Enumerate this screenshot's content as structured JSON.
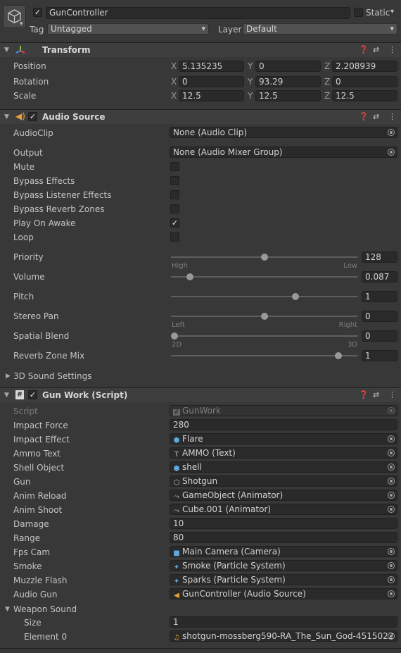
{
  "header": {
    "name": "GunController",
    "static_label": "Static",
    "tag_label": "Tag",
    "tag_value": "Untagged",
    "layer_label": "Layer",
    "layer_value": "Default"
  },
  "transform": {
    "title": "Transform",
    "rows": [
      {
        "label": "Position",
        "x": "5.135235",
        "y": "0",
        "z": "2.208939"
      },
      {
        "label": "Rotation",
        "x": "0",
        "y": "93.29",
        "z": "0"
      },
      {
        "label": "Scale",
        "x": "12.5",
        "y": "12.5",
        "z": "12.5"
      }
    ],
    "axis_x": "X",
    "axis_y": "Y",
    "axis_z": "Z"
  },
  "audio_source": {
    "title": "Audio Source",
    "audio_clip_label": "AudioClip",
    "audio_clip_value": "None (Audio Clip)",
    "output_label": "Output",
    "output_value": "None (Audio Mixer Group)",
    "toggles": [
      {
        "label": "Mute",
        "checked": false
      },
      {
        "label": "Bypass Effects",
        "checked": false
      },
      {
        "label": "Bypass Listener Effects",
        "checked": false
      },
      {
        "label": "Bypass Reverb Zones",
        "checked": false
      },
      {
        "label": "Play On Awake",
        "checked": true
      },
      {
        "label": "Loop",
        "checked": false
      }
    ],
    "priority": {
      "label": "Priority",
      "value": "128",
      "min_label": "High",
      "max_label": "Low",
      "fraction": 0.5
    },
    "volume": {
      "label": "Volume",
      "value": "0.087",
      "fraction": 0.087
    },
    "pitch": {
      "label": "Pitch",
      "value": "1",
      "fraction": 0.67
    },
    "stereo_pan": {
      "label": "Stereo Pan",
      "value": "0",
      "min_label": "Left",
      "max_label": "Right",
      "fraction": 0.5
    },
    "spatial_blend": {
      "label": "Spatial Blend",
      "value": "0",
      "min_label": "2D",
      "max_label": "3D",
      "fraction": 0.0
    },
    "reverb_zone_mix": {
      "label": "Reverb Zone Mix",
      "value": "1",
      "fraction": 0.91
    },
    "sound_3d_label": "3D Sound Settings"
  },
  "gun_work": {
    "title": "Gun Work (Script)",
    "script_label": "Script",
    "script_value": "GunWork",
    "rows": [
      {
        "label": "Impact Force",
        "value": "280",
        "kind": "text"
      },
      {
        "label": "Impact Effect",
        "value": "Flare",
        "kind": "obj",
        "icon": "prefab-icon",
        "glyph": "⬢",
        "color": "#5fa9e0"
      },
      {
        "label": "Ammo Text",
        "value": "AMMO (Text)",
        "kind": "obj",
        "icon": "text-icon",
        "glyph": "T",
        "color": "#c4c4c4"
      },
      {
        "label": "Shell Object",
        "value": "shell",
        "kind": "obj",
        "icon": "prefab-icon",
        "glyph": "⬢",
        "color": "#5fa9e0"
      },
      {
        "label": "Gun",
        "value": "Shotgun",
        "kind": "obj",
        "icon": "gameobject-icon",
        "glyph": "⬡",
        "color": "#c4c4c4"
      },
      {
        "label": "Anim Reload",
        "value": "GameObject (Animator)",
        "kind": "obj",
        "icon": "animator-icon",
        "glyph": "⤳",
        "color": "#c4c4c4"
      },
      {
        "label": "Anim Shoot",
        "value": "Cube.001 (Animator)",
        "kind": "obj",
        "icon": "animator-icon",
        "glyph": "⤳",
        "color": "#c4c4c4"
      },
      {
        "label": "Damage",
        "value": "10",
        "kind": "text"
      },
      {
        "label": "Range",
        "value": "80",
        "kind": "text"
      },
      {
        "label": "Fps Cam",
        "value": "Main Camera (Camera)",
        "kind": "obj",
        "icon": "camera-icon",
        "glyph": "■",
        "color": "#5fa9e0"
      },
      {
        "label": "Smoke",
        "value": "Smoke (Particle System)",
        "kind": "obj",
        "icon": "particle-icon",
        "glyph": "✦",
        "color": "#5fa9e0"
      },
      {
        "label": "Muzzle Flash",
        "value": "Sparks (Particle System)",
        "kind": "obj",
        "icon": "particle-icon",
        "glyph": "✦",
        "color": "#5fa9e0"
      },
      {
        "label": "Audio Gun",
        "value": "GunController (Audio Source)",
        "kind": "obj",
        "icon": "audio-source-icon",
        "glyph": "◀",
        "color": "#e8a23a"
      }
    ],
    "weapon_sound_label": "Weapon Sound",
    "size_label": "Size",
    "size_value": "1",
    "element0_label": "Element 0",
    "element0_value": "shotgun-mossberg590-RA_The_Sun_God-4515022"
  }
}
